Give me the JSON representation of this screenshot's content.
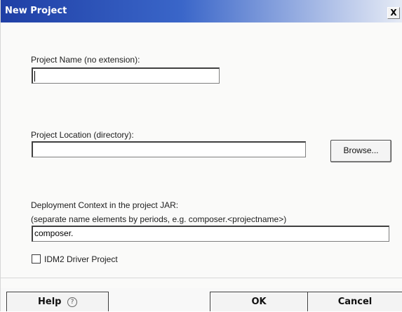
{
  "window": {
    "title": "New Project",
    "close_glyph": "X"
  },
  "project_name": {
    "label": "Project Name (no extension):",
    "value": ""
  },
  "project_location": {
    "label": "Project Location (directory):",
    "value": ""
  },
  "browse_label": "Browse...",
  "deployment": {
    "label": "Deployment Context in the project JAR:",
    "hint": "(separate name elements by periods, e.g. composer.<projectname>)",
    "value": "composer."
  },
  "checkbox": {
    "label": "IDM2 Driver Project",
    "checked": false
  },
  "footer": {
    "help_label": "Help",
    "help_icon_glyph": "?",
    "ok_label": "OK",
    "cancel_label": "Cancel"
  },
  "icons": {
    "close": "close-icon",
    "help": "help-icon"
  }
}
